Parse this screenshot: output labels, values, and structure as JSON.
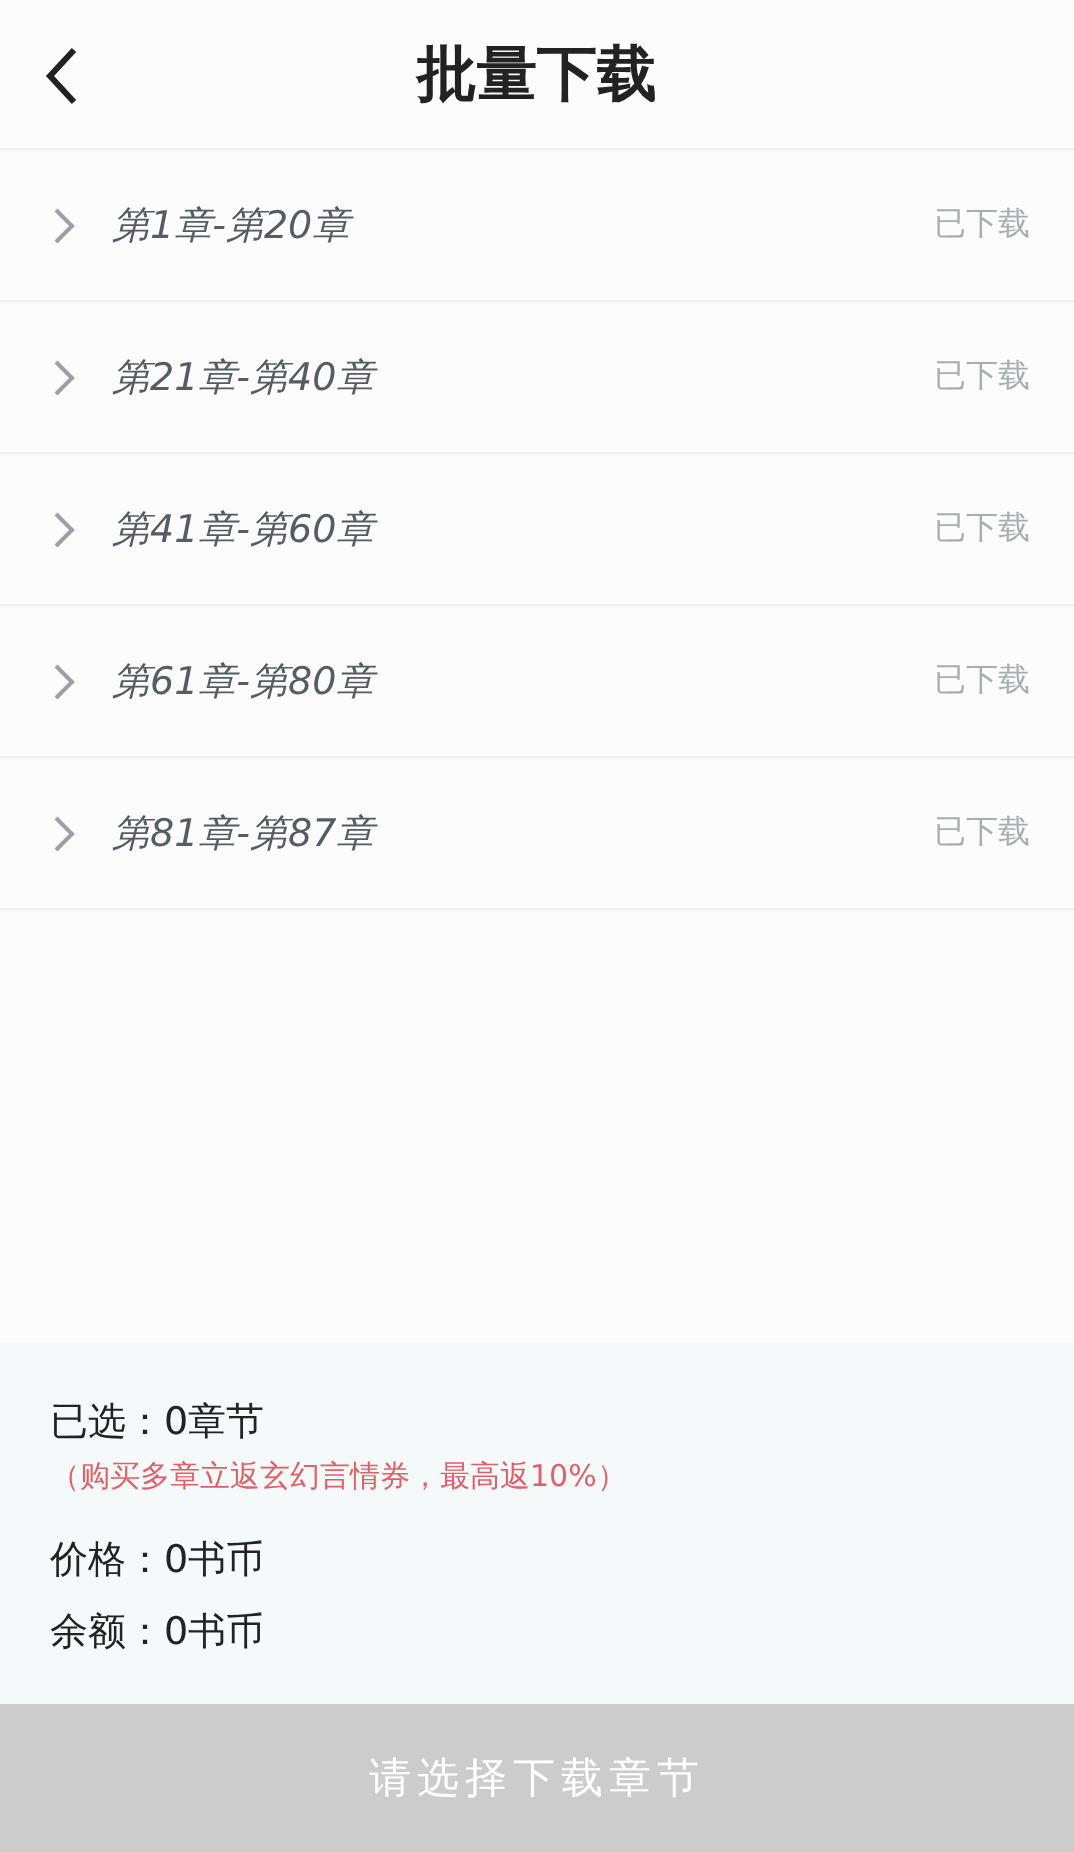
{
  "header": {
    "title": "批量下载"
  },
  "chapters": [
    {
      "range": "第1章-第20章",
      "status": "已下载",
      "expanded": false
    },
    {
      "range": "第21章-第40章",
      "status": "已下载",
      "expanded": false
    },
    {
      "range": "第41章-第60章",
      "status": "已下载",
      "expanded": false
    },
    {
      "range": "第61章-第80章",
      "status": "已下载",
      "expanded": false
    },
    {
      "range": "第81章-第87章",
      "status": "已下载",
      "expanded": false
    }
  ],
  "summary": {
    "selected": "已选：0章节",
    "promo": "（购买多章立返玄幻言情券，最高返10%）",
    "price": "价格：0书币",
    "balance": "余额：0书币"
  },
  "download_button": {
    "label": "请选择下载章节",
    "disabled": true
  }
}
